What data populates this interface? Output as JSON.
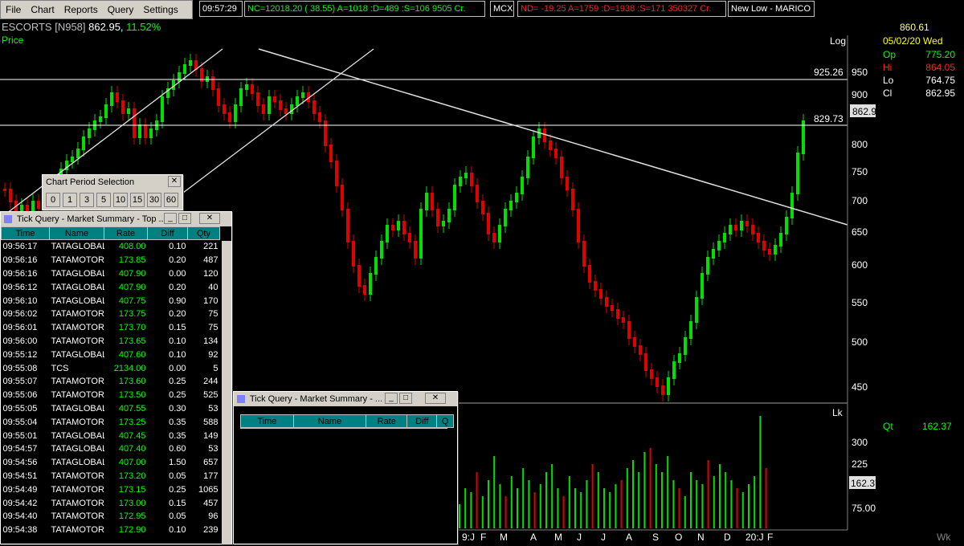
{
  "menu": [
    "File",
    "Chart",
    "Reports",
    "Query",
    "Settings"
  ],
  "tickers": {
    "time": "09:57:29",
    "nse": "NC=12018.20 (  38.55) A=1018 :D=489 :S=106  9505 Cr.",
    "mcx": "MCX",
    "nd": "ND= -19.25 A=1759 :D=1938 :S=171  350327 Cr.",
    "alert": "New Low - MARICO"
  },
  "header": {
    "symbol": "ESCORTS [N958]",
    "price": "862.95,",
    "change": "11.52%",
    "series": "Price"
  },
  "axis": {
    "scale": "Log",
    "right_prices": [
      "950",
      "900",
      "850",
      "800",
      "750",
      "700",
      "650",
      "600",
      "550",
      "500",
      "450"
    ],
    "line_labels": [
      "925.26",
      "829.73"
    ],
    "current_price": "862.95",
    "vol_unit": "Lk",
    "vol_ticks": [
      "300",
      "225",
      "75.00"
    ],
    "vol_current": "162.37",
    "months": [
      "9:J",
      "F",
      "M",
      "A",
      "M",
      "J",
      "J",
      "A",
      "S",
      "O",
      "N",
      "D",
      "20:J",
      "F"
    ],
    "period": "Wk"
  },
  "side": {
    "value": "860.61",
    "date": "05/02/20 Wed",
    "rows": [
      {
        "k": "Op",
        "v": "775.20"
      },
      {
        "k": "Hi",
        "v": "864.05"
      },
      {
        "k": "Lo",
        "v": "764.75"
      },
      {
        "k": "Cl",
        "v": "862.95"
      }
    ],
    "qt_label": "Qt",
    "qt_value": "162.37"
  },
  "colors": {
    "up": "#00e000",
    "down": "#e00000",
    "teal": "#008080",
    "ticker_green": "#00ff00",
    "ticker_red": "#ff2020"
  },
  "period_window": {
    "title": "Chart Period Selection",
    "buttons": [
      "0",
      "1",
      "3",
      "5",
      "10",
      "15",
      "30",
      "60"
    ]
  },
  "tick_window": {
    "title": "Tick Query - Market Summary - Top ...",
    "columns": [
      "Time",
      "Name",
      "Rate",
      "Diff",
      "Qty"
    ],
    "rows": [
      [
        "09:56:17",
        "TATAGLOBAL",
        "408.00",
        "0.10",
        "221"
      ],
      [
        "09:56:16",
        "TATAMOTOR",
        "173.85",
        "0.20",
        "487"
      ],
      [
        "09:56:16",
        "TATAGLOBAL",
        "407.90",
        "0.00",
        "120"
      ],
      [
        "09:56:12",
        "TATAGLOBAL",
        "407.90",
        "0.20",
        "40"
      ],
      [
        "09:56:10",
        "TATAGLOBAL",
        "407.75",
        "0.90",
        "170"
      ],
      [
        "09:56:02",
        "TATAMOTOR",
        "173.75",
        "0.20",
        "75"
      ],
      [
        "09:56:01",
        "TATAMOTOR",
        "173.70",
        "0.15",
        "75"
      ],
      [
        "09:56:00",
        "TATAMOTOR",
        "173.65",
        "0.10",
        "134"
      ],
      [
        "09:55:12",
        "TATAGLOBAL",
        "407.60",
        "0.10",
        "92"
      ],
      [
        "09:55:08",
        "TCS",
        "2134.00",
        "0.00",
        "5"
      ],
      [
        "09:55:07",
        "TATAMOTOR",
        "173.60",
        "0.25",
        "244"
      ],
      [
        "09:55:06",
        "TATAMOTOR",
        "173.50",
        "0.25",
        "525"
      ],
      [
        "09:55:05",
        "TATAGLOBAL",
        "407.55",
        "0.30",
        "53"
      ],
      [
        "09:55:04",
        "TATAMOTOR",
        "173.25",
        "0.35",
        "588"
      ],
      [
        "09:55:01",
        "TATAGLOBAL",
        "407.45",
        "0.35",
        "149"
      ],
      [
        "09:54:57",
        "TATAGLOBAL",
        "407.40",
        "0.60",
        "53"
      ],
      [
        "09:54:56",
        "TATAGLOBAL",
        "407.00",
        "1.50",
        "657"
      ],
      [
        "09:54:51",
        "TATAMOTOR",
        "173.20",
        "0.05",
        "177"
      ],
      [
        "09:54:49",
        "TATAMOTOR",
        "173.15",
        "0.25",
        "1065"
      ],
      [
        "09:54:42",
        "TATAMOTOR",
        "173.00",
        "0.15",
        "457"
      ],
      [
        "09:54:40",
        "TATAMOTOR",
        "172.95",
        "0.05",
        "96"
      ],
      [
        "09:54:38",
        "TATAMOTOR",
        "172.90",
        "0.10",
        "239"
      ]
    ]
  },
  "tick_window2": {
    "title": "Tick Query - Market Summary - ...",
    "columns": [
      "Time",
      "Name",
      "Rate",
      "Diff",
      "Q"
    ]
  }
}
